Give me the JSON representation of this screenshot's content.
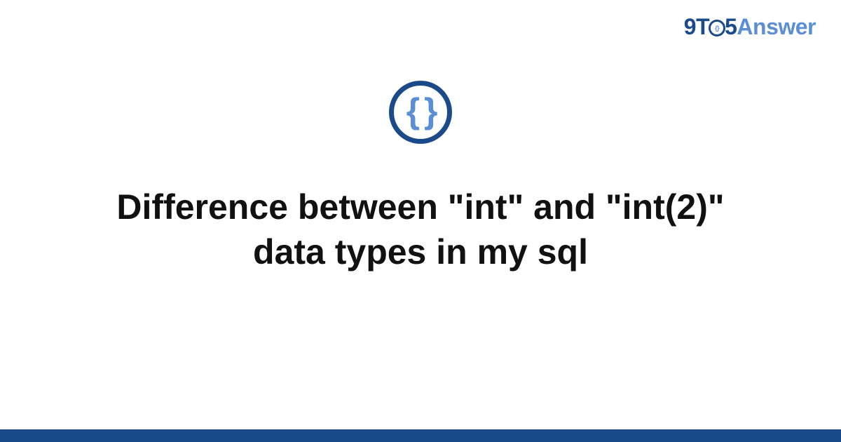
{
  "logo": {
    "nine": "9",
    "t": "T",
    "o_inner": "{}",
    "five": "5",
    "answer": "Answer"
  },
  "icon": {
    "braces": "{ }"
  },
  "title": "Difference between \"int\" and \"int(2)\" data types in my sql",
  "colors": {
    "primary": "#1a4a8a",
    "accent": "#5a8fd4",
    "text": "#111111",
    "background": "#ffffff"
  }
}
